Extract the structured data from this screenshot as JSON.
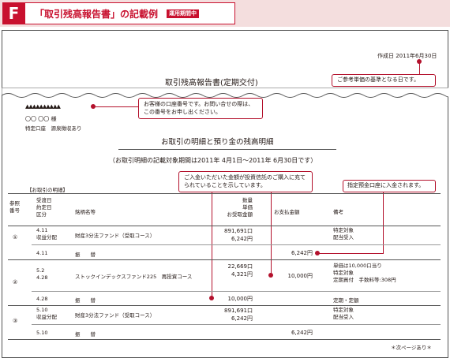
{
  "header": {
    "letter": "F",
    "title": "「取引残高報告書」の記載例",
    "badge": "運用期間中"
  },
  "document": {
    "created_date": "作成日 2011年6月30日",
    "title": "取引残高報告書(定期交付)",
    "customer_code": "▲▲▲▲▲▲▲▲▲▲",
    "customer_name": "〇〇 〇〇 様",
    "account_type": "特定口座　源泉徴収あり",
    "section_title": "お取引の明細と預り金の残高明細",
    "period_note": "（お取引明細の記載対象期間は2011年 4月1日～2011年 6月30日です）",
    "table_label": "【お取引の明細】",
    "footer_note": "＊次ページあり＊"
  },
  "callouts": {
    "reference_date": "ご参考単価の基準となる日です。",
    "account_number": "お客様の口座番号です。お問い合せの際は、この番号をお申し出ください。",
    "reinvest": "ご入金いただいた金額が投資信託のご購入に充てられていることを示しています。",
    "designated_account": "指定預金口座に入金されます。"
  },
  "table": {
    "headers": {
      "ref": [
        "参照",
        "番号"
      ],
      "date": [
        "受渡日",
        "約定日",
        "区分"
      ],
      "name": "銘柄名等",
      "qty": [
        "数量",
        "単価",
        "お受取金額"
      ],
      "pay": "お支払金額",
      "note": "備考"
    },
    "rows": [
      {
        "ref": "①",
        "date1": "4.11",
        "date2": "収益分配",
        "name": "財産3分法ファンド（受取コース）",
        "qty": "891,691口",
        "price": "6,242円",
        "pay": "",
        "note1": "特定対象",
        "note2": "配当受入",
        "note3": ""
      },
      {
        "ref": "",
        "date1": "4.11",
        "date2": "",
        "name": "振　　替",
        "qty": "",
        "price": "",
        "pay": "6,242円",
        "note1": "",
        "note2": "",
        "note3": ""
      },
      {
        "ref": "②",
        "date1": "5.2",
        "date2": "4.28",
        "name": "ストックインデックスファンド225　再投資コース",
        "qty": "22,669口",
        "price": "4,321円",
        "pay": "10,000円",
        "note1": "単価は10,000口当り",
        "note2": "特定対象",
        "note3": "定期買付　手数料等:308円"
      },
      {
        "ref": "",
        "date1": "4.28",
        "date2": "",
        "name": "振　　替",
        "qty": "",
        "price": "10,000円",
        "pay": "",
        "note1": "定期・定額",
        "note2": "",
        "note3": ""
      },
      {
        "ref": "③",
        "date1": "5.10",
        "date2": "収益分配",
        "name": "財産3分法ファンド（受取コース）",
        "qty": "891,691口",
        "price": "6,242円",
        "pay": "",
        "note1": "特定対象",
        "note2": "配当受入",
        "note3": ""
      },
      {
        "ref": "",
        "date1": "5.10",
        "date2": "",
        "name": "振　　替",
        "qty": "",
        "price": "",
        "pay": "6,242円",
        "note1": "",
        "note2": "",
        "note3": ""
      }
    ]
  },
  "colors": {
    "accent": "#c8102e",
    "header_band": "#f4dede"
  }
}
